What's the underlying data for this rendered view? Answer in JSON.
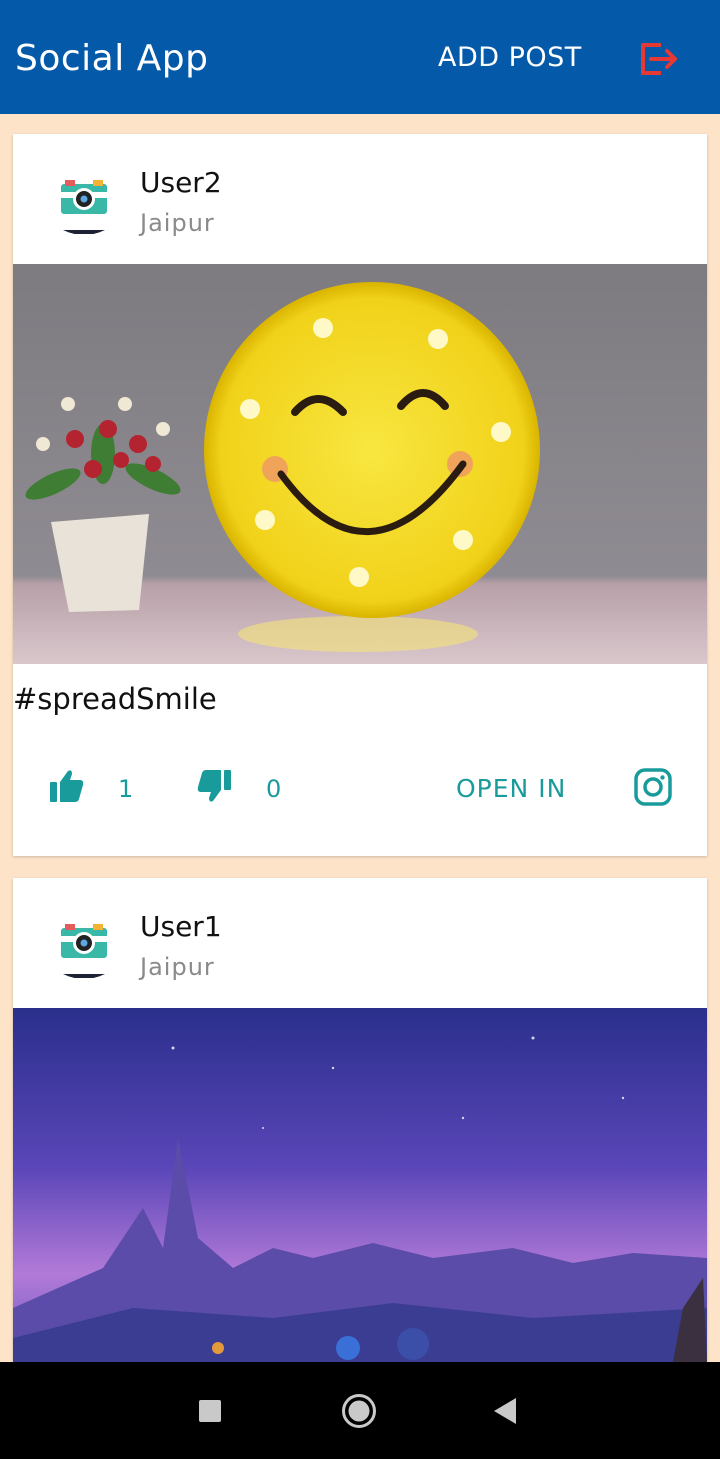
{
  "appbar": {
    "title": "Social App",
    "add_post_label": "ADD POST",
    "logout_icon": "logout-icon",
    "background": "#045aa8",
    "logout_color": "#e53935"
  },
  "feed_background": "#fde3c8",
  "accent_color": "#1a9b9b",
  "posts": [
    {
      "username": "User2",
      "location": "Jaipur",
      "avatar_icon": "camera-icon",
      "image": "smiley-lamp-photo",
      "caption": "#spreadSmile",
      "likes": "1",
      "dislikes": "0",
      "open_in_label": "OPEN IN",
      "open_in_icon": "instagram-icon"
    },
    {
      "username": "User1",
      "location": "Jaipur",
      "avatar_icon": "camera-icon",
      "image": "night-mountains-illustration"
    }
  ],
  "navbar": {
    "buttons": [
      "recents-square-icon",
      "home-circle-icon",
      "back-triangle-icon"
    ]
  }
}
